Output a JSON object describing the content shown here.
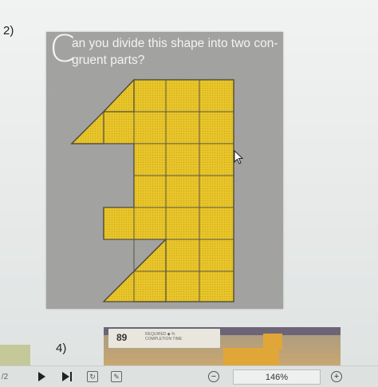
{
  "questions": {
    "q2_number": "2)",
    "q4_number": "4)"
  },
  "card": {
    "drop_cap": "C",
    "text": "an you divide this shape into two con-gruent parts?"
  },
  "thumbnail": {
    "score": "89",
    "meta_line1": "REQUIRED ◆ %",
    "meta_line2": "COMPLETION    TIME"
  },
  "toolbar": {
    "page_number": "/2",
    "zoom_level": "146%",
    "zoom_out_symbol": "−",
    "zoom_in_symbol": "+"
  },
  "colors": {
    "shape_fill": "#e8c52a",
    "grid_line": "#5a5644",
    "card_bg": "#a2a3a1"
  },
  "icons": [
    "play-icon",
    "next-page-icon",
    "rotate-icon",
    "annotate-icon",
    "zoom-out-icon",
    "zoom-in-icon",
    "cursor-icon"
  ]
}
